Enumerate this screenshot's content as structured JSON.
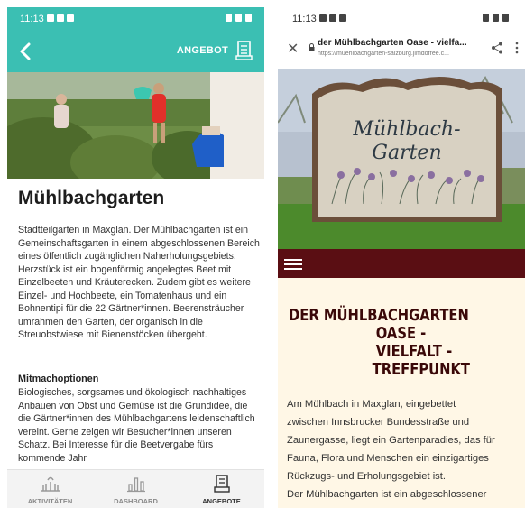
{
  "left_phone": {
    "status": {
      "time": "11:13"
    },
    "appbar": {
      "action_label": "ANGEBOT"
    },
    "content": {
      "title": "Mühlbachgarten",
      "body": "Stadtteilgarten in Maxglan. Der Mühlbachgarten ist ein Gemeinschaftsgarten in einem abgeschlossenen Bereich eines öffentlich zugänglichen Naherholungsgebiets. Herzstück ist ein bogenförmig angelegtes Beet mit Einzelbeeten und Kräuterecken. Zudem gibt es weitere Einzel- und Hochbeete, ein Tomatenhaus und ein Bohnentipi für die 22 Gärtner*innen. Beerensträucher umrahmen den Garten, der organisch in die Streuobstwiese mit Bienenstöcken übergeht.",
      "section_title": "Mitmachoptionen",
      "section_body": "Biologisches, sorgsames und ökologisch nachhaltiges Anbauen von Obst und Gemüse ist die Grundidee, die die Gärtner*innen des Mühlbachgartens leidenschaftlich vereint. Gerne zeigen wir Besucher*innen unseren Schatz. Bei Interesse für die Beetvergabe fürs kommende Jahr"
    },
    "bottom_nav": [
      {
        "label": "AKTIVITÄTEN",
        "icon": "activities-icon",
        "active": false
      },
      {
        "label": "DASHBOARD",
        "icon": "dashboard-icon",
        "active": false
      },
      {
        "label": "ANGEBOTE",
        "icon": "offers-icon",
        "active": true
      }
    ],
    "colors": {
      "accent": "#3bbfb3",
      "nav_bg": "#f3f3f3"
    }
  },
  "right_phone": {
    "status": {
      "time": "11:13"
    },
    "browser": {
      "page_title": "der Mühlbachgarten Oase - vielfa...",
      "url": "https://muehlbachgarten-salzburg.jimdofree.c..."
    },
    "sign_text": [
      "Mühlbach-",
      "Garten"
    ],
    "heading": [
      "DER MÜHLBACHGARTEN",
      "OASE - VIELFALT -",
      "TREFFPUNKT"
    ],
    "body_lines": [
      "Am Mühlbach in Maxglan, eingebettet",
      "zwischen Innsbrucker Bundesstraße und",
      "Zaunergasse, liegt ein Gartenparadies, das für",
      "Fauna, Flora und Menschen ein einzigartiges",
      "Rückzugs- und Erholungsgebiet ist.",
      "Der Mühlbachgarten ist ein abgeschlossener"
    ],
    "colors": {
      "menubar": "#5a0e13",
      "heading": "#3a0808",
      "page_bg": "#fff7e6"
    }
  }
}
